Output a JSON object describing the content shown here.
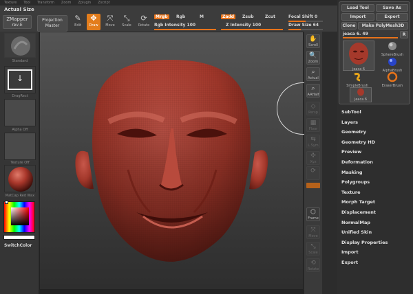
{
  "menubar": [
    "Texture",
    "Tool",
    "Transform",
    "Zoom",
    "Zplugin",
    "Zscript"
  ],
  "toolbar": {
    "actual_size": "Actual Size",
    "zmapper_line1": "ZMapper",
    "zmapper_line2": "rev-E",
    "projection_line1": "Projection",
    "projection_line2": "Master",
    "tools": [
      "Edit",
      "Draw",
      "Move",
      "Scale",
      "Rotate"
    ],
    "active_tool": "Draw",
    "mrgb": "Mrgb",
    "rgb": "Rgb",
    "m": "M",
    "zadd": "Zadd",
    "zsub": "Zsub",
    "zcut": "Zcut",
    "rgb_intensity_label": "Rgb Intensity",
    "rgb_intensity": "100",
    "rgb_intensity_value": 1.0,
    "z_intensity_label": "Z Intensity",
    "z_intensity": "100",
    "z_intensity_value": 1.0,
    "focal_shift_label": "Focal Shift",
    "focal_shift": "0",
    "focal_shift_value": 0.5,
    "draw_size_label": "Draw Size",
    "draw_size": "64",
    "draw_size_value": 0.35
  },
  "left_shelf": {
    "standard_caption": "Standard",
    "dragrect_caption": "DragRect",
    "alpha_caption": "Alpha Off",
    "texture_caption": "Texture Off",
    "matcap_caption": "MatCap Red Wax",
    "switch_color": "SwitchColor"
  },
  "right_dock": [
    "Scroll",
    "Zoom",
    "Actual",
    "AAHalf",
    "Persp",
    "Floor",
    "L.Sym",
    "Xyz",
    "",
    "",
    "Frame",
    "Move",
    "Scale",
    "Rotate"
  ],
  "tool_panel": {
    "load_tool": "Load Tool",
    "save_as": "Save As",
    "import": "Import",
    "export": "Export",
    "clone": "Clone",
    "make_polymesh": "Make PolyMesh3D",
    "current_tool": "jeaca 6. 49",
    "r_button": "R",
    "brushes": [
      "jeaca 6",
      "SphereBrush",
      "AlphaBrush",
      "SimpleBrush",
      "EraserBrush",
      "jeaca 6"
    ]
  },
  "menu_list": [
    "SubTool",
    "Layers",
    "Geometry",
    "Geometry HD",
    "Preview",
    "Deformation",
    "Masking",
    "Polygroups",
    "Texture",
    "Morph Target",
    "Displacement",
    "NormalMap",
    "Unified Skin",
    "Display Properties",
    "Import",
    "Export"
  ],
  "colors": {
    "accent": "#e8731a",
    "head": "#a5392b"
  },
  "icons": [
    "edit-icon",
    "draw-icon",
    "move-icon",
    "scale-icon",
    "rotate-icon",
    "scroll-icon",
    "zoom-icon",
    "frame-icon"
  ]
}
